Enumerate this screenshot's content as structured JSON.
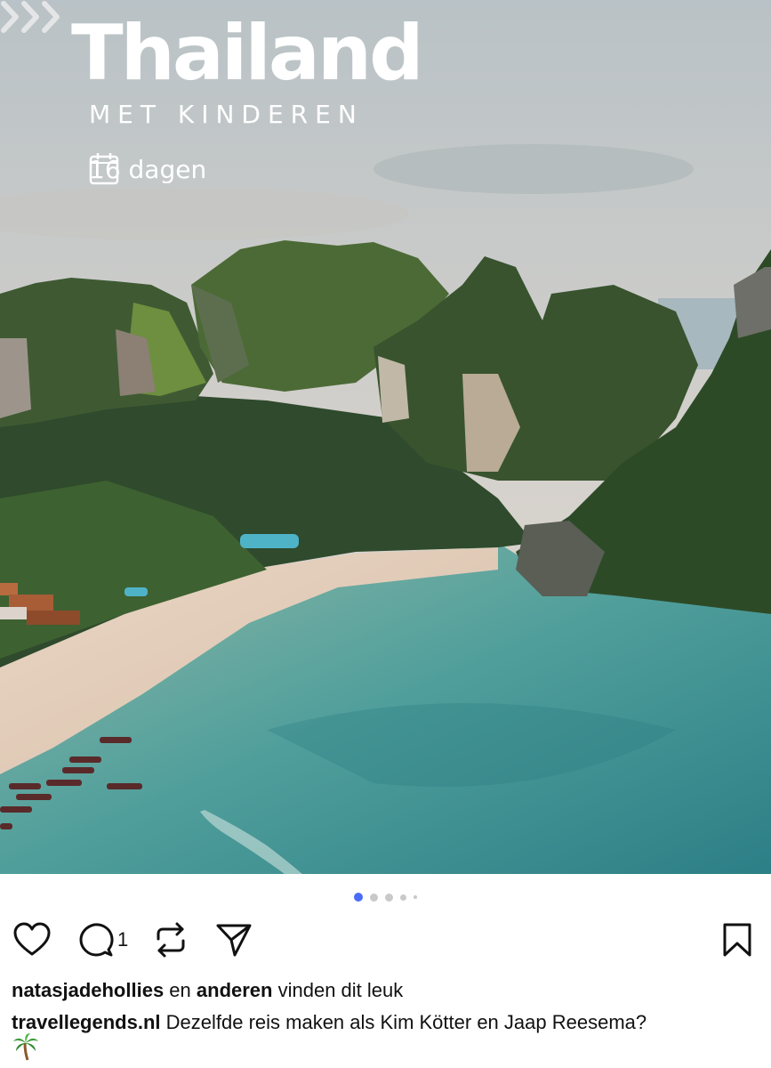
{
  "post_image": {
    "title": "Thailand",
    "subtitle": "MET KINDEREN",
    "duration": "16 dagen",
    "icons": {
      "calendar": "calendar-icon",
      "next": "chevrons-right-icon"
    }
  },
  "carousel": {
    "total": 5,
    "active_index": 0
  },
  "actions": {
    "like_icon": "heart-icon",
    "comment_icon": "comment-icon",
    "comment_count": "1",
    "repost_icon": "repost-icon",
    "share_icon": "send-icon",
    "save_icon": "bookmark-icon"
  },
  "likes": {
    "user": "natasjadehollies",
    "connector": " en ",
    "others": "anderen",
    "suffix": " vinden dit leuk"
  },
  "caption": {
    "author": "travellegends.nl",
    "text": " Dezelfde reis maken als Kim Kötter en Jaap Reesema?",
    "emoji": "palm-tree-icon"
  },
  "colors": {
    "accent": "#4a6cf7",
    "text": "#111111"
  }
}
